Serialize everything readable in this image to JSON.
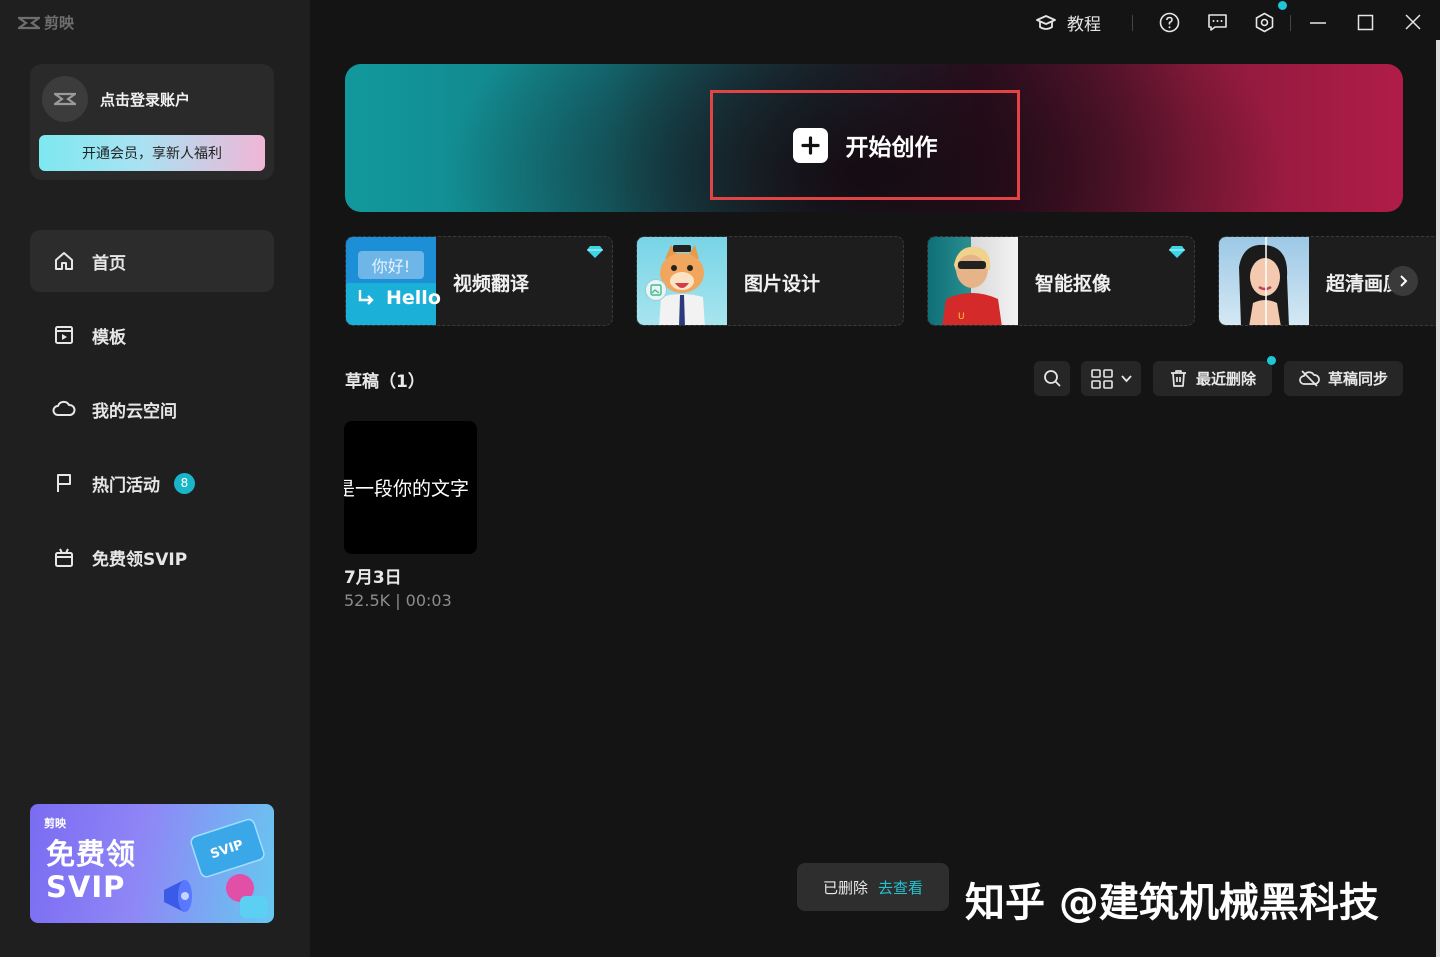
{
  "app": {
    "logo_text": "剪映"
  },
  "account": {
    "login_label": "点击登录账户",
    "vip_button": "开通会员，享新人福利"
  },
  "nav": {
    "items": [
      {
        "label": "首页",
        "icon": "home-icon",
        "active": true
      },
      {
        "label": "模板",
        "icon": "template-icon"
      },
      {
        "label": "我的云空间",
        "icon": "cloud-icon"
      },
      {
        "label": "热门活动",
        "icon": "flag-icon",
        "badge": "8"
      },
      {
        "label": "免费领SVIP",
        "icon": "gift-icon"
      }
    ]
  },
  "promo": {
    "logo": "剪映",
    "line1": "免费领",
    "line2": "SVIP",
    "card_text": "SVIP"
  },
  "titlebar": {
    "tutorial_label": "教程"
  },
  "hero": {
    "create_label": "开始创作"
  },
  "features": [
    {
      "label": "视频翻译",
      "thumb_text_top": "你好!",
      "thumb_text_bottom": "Hello",
      "premium": true
    },
    {
      "label": "图片设计",
      "premium": false
    },
    {
      "label": "智能抠像",
      "premium": true
    },
    {
      "label": "超清画质",
      "premium": false
    }
  ],
  "drafts": {
    "title": "草稿（1）",
    "recent_delete_label": "最近删除",
    "sync_label": "草稿同步",
    "items": [
      {
        "thumb_text": "是一段你的文字",
        "name": "7月3日",
        "meta": "52.5K | 00:03"
      }
    ]
  },
  "toast": {
    "message": "已删除",
    "link": "去查看"
  },
  "watermark": "知乎 @建筑机械黑科技",
  "colors": {
    "accent": "#19b6c7",
    "highlight_border": "#e04444",
    "background": "#141414",
    "sidebar": "#1f1f1f"
  }
}
